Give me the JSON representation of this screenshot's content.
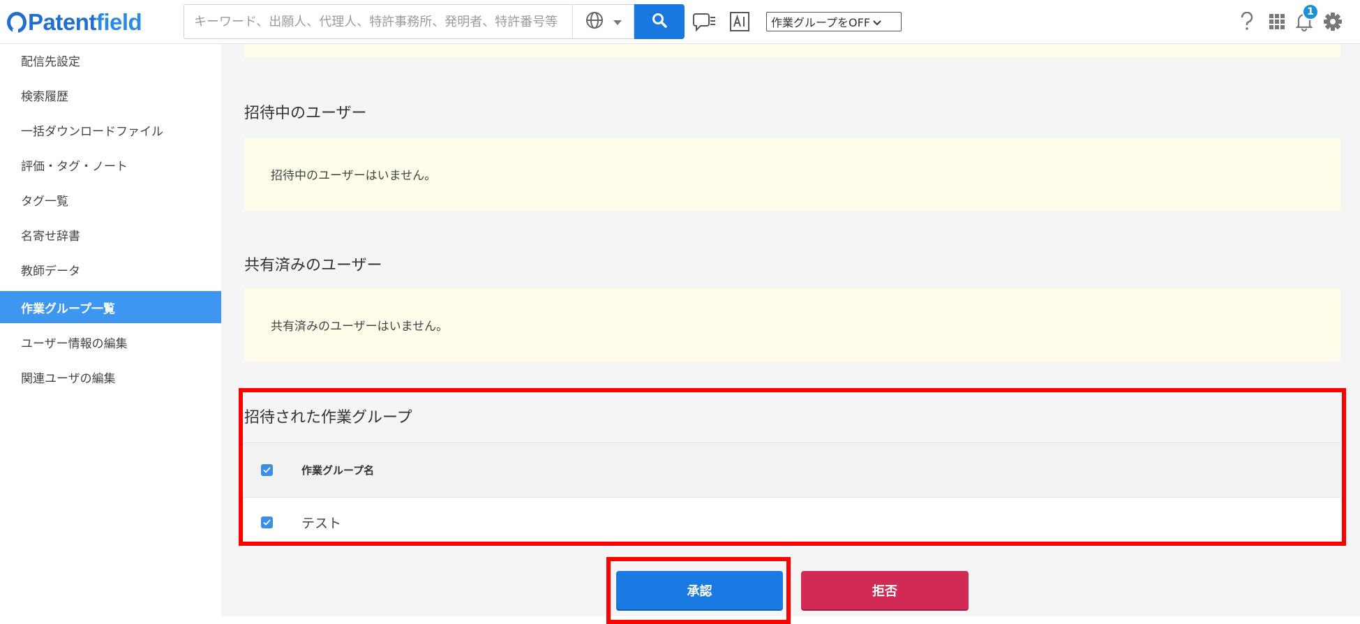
{
  "header": {
    "logo_prefix": "Patent",
    "logo_suffix": "field",
    "search_placeholder": "キーワード、出願人、代理人、特許事務所、発明者、特許番号等",
    "workgroup_select": "作業グループをOFF",
    "notification_count": "1",
    "icons": [
      "globe-icon",
      "caret-down-icon",
      "search-icon",
      "chat-list-icon",
      "ai-icon",
      "help-icon",
      "apps-grid-icon",
      "bell-icon",
      "gear-icon"
    ],
    "colors": {
      "brand": "#1f6fcf",
      "search_button": "#1878e0",
      "badge": "#1e90d8"
    }
  },
  "sidebar": {
    "active_color": "#3d96ef",
    "items": [
      {
        "label": "配信先設定"
      },
      {
        "label": "検索履歴"
      },
      {
        "label": "一括ダウンロードファイル"
      },
      {
        "label": "評価・タグ・ノート"
      },
      {
        "label": "タグ一覧"
      },
      {
        "label": "名寄せ辞書"
      },
      {
        "label": "教師データ"
      },
      {
        "label": "作業グループ一覧",
        "active": true
      },
      {
        "label": "ユーザー情報の編集"
      },
      {
        "label": "関連ユーザの編集"
      }
    ]
  },
  "main": {
    "invited_users": {
      "title": "招待中のユーザー",
      "empty_text": "招待中のユーザーはいません。"
    },
    "shared_users": {
      "title": "共有済みのユーザー",
      "empty_text": "共有済みのユーザーはいません。"
    },
    "invited_workgroups": {
      "title": "招待された作業グループ",
      "column_header": "作業グループ名",
      "rows": [
        {
          "name": "テスト",
          "checked": true
        }
      ],
      "header_checked": true
    },
    "buttons": {
      "approve": "承認",
      "reject": "拒否"
    },
    "colors": {
      "approve": "#1a7ae3",
      "reject": "#d12b55",
      "highlight": "#ff0000",
      "note_bg": "#fdfde9"
    }
  }
}
